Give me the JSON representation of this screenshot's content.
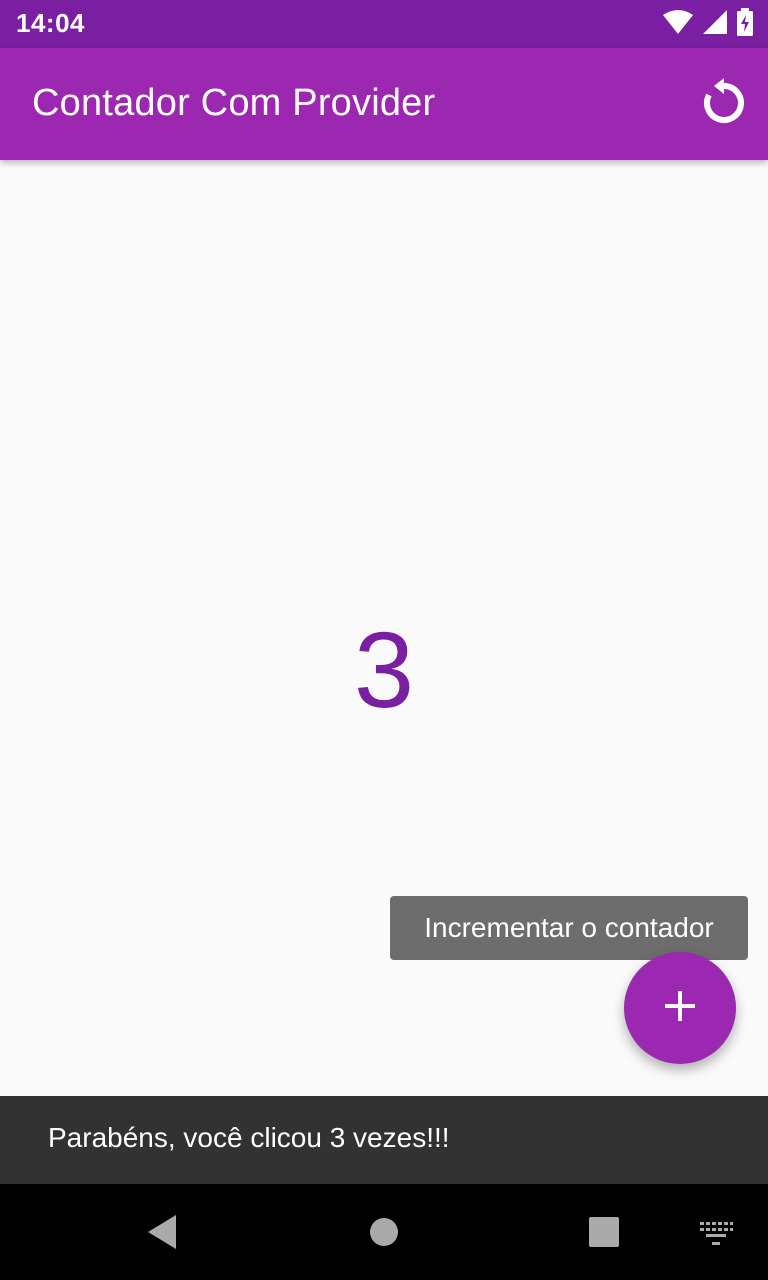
{
  "status_bar": {
    "time": "14:04",
    "icons": [
      "wifi-icon",
      "signal-icon",
      "battery-charging-icon"
    ]
  },
  "app_bar": {
    "title": "Contador Com Provider",
    "action_icon": "refresh-icon"
  },
  "main": {
    "counter_value": "3"
  },
  "tooltip": {
    "text": "Incrementar o contador"
  },
  "fab": {
    "icon": "add-icon"
  },
  "snackbar": {
    "message": "Parabéns, você clicou 3 vezes!!!"
  },
  "nav_bar": {
    "icons": [
      "back-icon",
      "home-icon",
      "recents-icon",
      "keyboard-icon"
    ]
  },
  "colors": {
    "primary": "#9c27b0",
    "primary_dark": "#7b1fa2",
    "counter_text": "#7b1fa2",
    "background": "#fafafa",
    "snackbar": "#323232"
  }
}
